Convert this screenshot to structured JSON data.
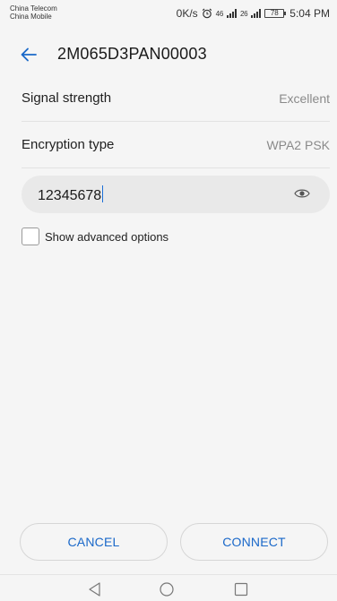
{
  "status_bar": {
    "carrier_1": "China Telecom",
    "carrier_2": "China Mobile",
    "speed": "0K/s",
    "network_1": "46",
    "network_2": "26",
    "battery": "78",
    "time": "5:04 PM"
  },
  "app_bar": {
    "title": "2M065D3PAN00003",
    "back_icon": "arrow-left-icon"
  },
  "rows": [
    {
      "label": "Signal strength",
      "value": "Excellent"
    },
    {
      "label": "Encryption type",
      "value": "WPA2 PSK"
    }
  ],
  "password": {
    "value": "12345678",
    "toggle_icon": "eye-icon"
  },
  "advanced": {
    "label": "Show advanced options",
    "checked": false
  },
  "buttons": {
    "cancel": "CANCEL",
    "connect": "CONNECT"
  },
  "nav": {
    "back_icon": "triangle-back-icon",
    "home_icon": "circle-home-icon",
    "recent_icon": "square-recent-icon"
  },
  "colors": {
    "accent": "#1a68c9",
    "caret": "#1b6fd8",
    "background": "#f5f5f5",
    "field": "#e9e9e9"
  }
}
